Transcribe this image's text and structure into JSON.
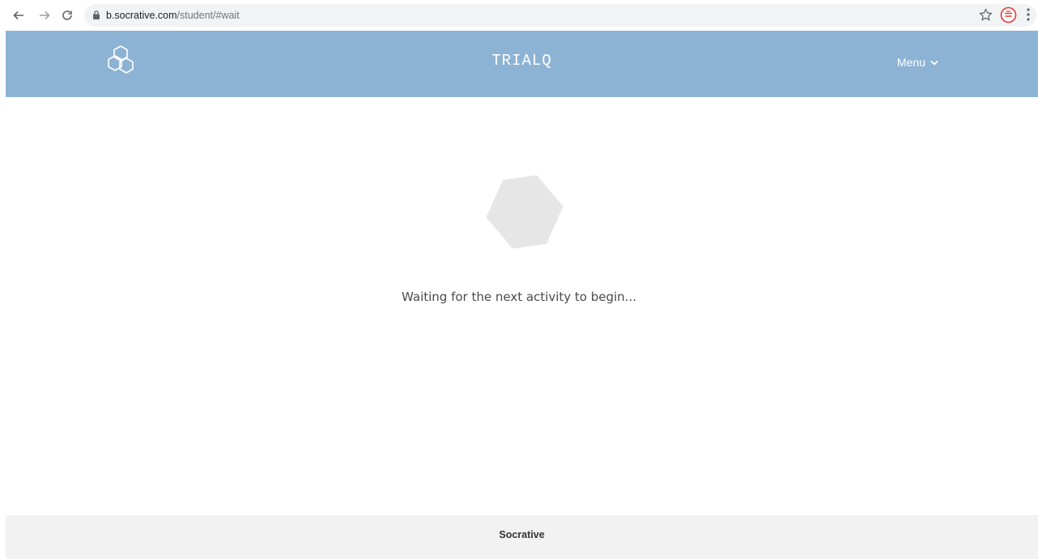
{
  "browser": {
    "url_host": "b.socrative.com",
    "url_path": "/student/#wait",
    "back_icon": "arrow-left-icon",
    "forward_icon": "arrow-right-icon",
    "reload_icon": "reload-icon",
    "lock_icon": "lock-icon",
    "bookmark_icon": "star-icon",
    "extension_icon": "extension-icon",
    "menu_icon": "kebab-menu-icon"
  },
  "header": {
    "room_name": "TRIALQ",
    "menu_label": "Menu",
    "background": "#8db3d4",
    "text_color": "#ffffff",
    "logo_icon": "socrative-hexagon-logo-icon"
  },
  "main": {
    "status_message": "Waiting for the next activity to begin...",
    "hex_color": "#e6e6e6"
  },
  "footer": {
    "label": "Socrative",
    "background": "#f2f2f2"
  }
}
